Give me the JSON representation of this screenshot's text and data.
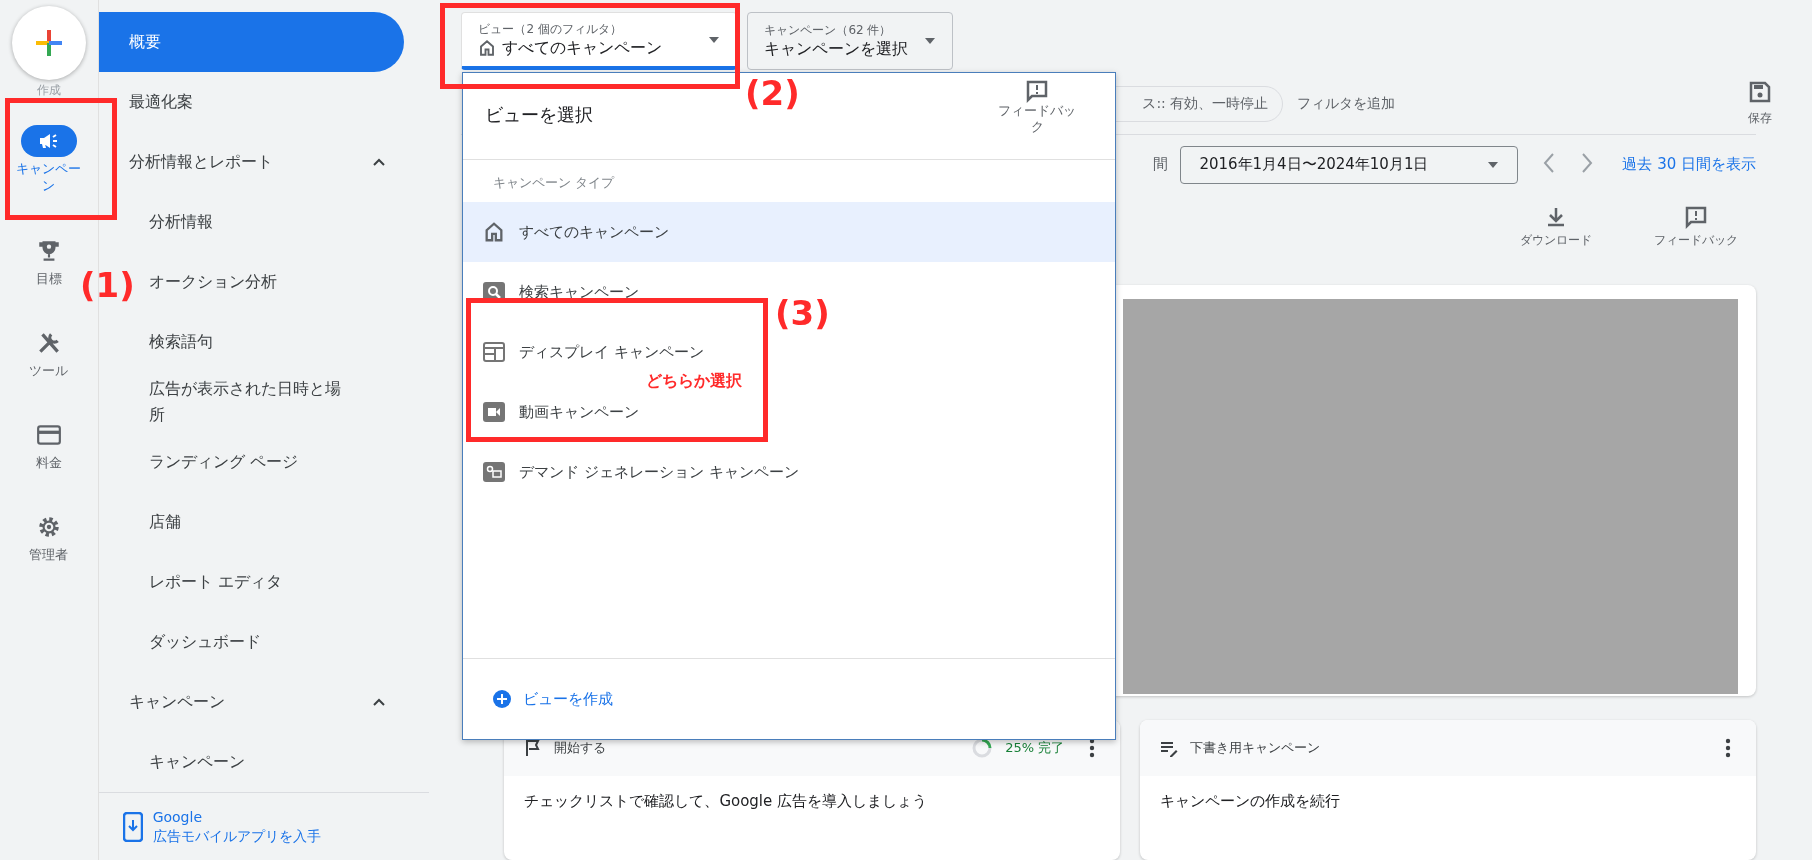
{
  "rail": {
    "create_label": "作成",
    "items": [
      {
        "label": "キャンペーン",
        "kind": "megaphone",
        "selected": true
      },
      {
        "label": "目標",
        "kind": "trophy",
        "selected": false
      },
      {
        "label": "ツール",
        "kind": "tools",
        "selected": false
      },
      {
        "label": "料金",
        "kind": "card",
        "selected": false
      },
      {
        "label": "管理者",
        "kind": "gear",
        "selected": false
      }
    ]
  },
  "sidebar": {
    "items": [
      {
        "label": "概要",
        "selected": true
      },
      {
        "label": "最適化案",
        "selected": false
      },
      {
        "label": "分析情報とレポート",
        "selected": false,
        "expanded": true,
        "children": [
          {
            "label": "分析情報",
            "selected": false
          },
          {
            "label": "オークション分析",
            "selected": false
          },
          {
            "label": "検索語句",
            "selected": false
          },
          {
            "label": "広告が表示された日時と場所",
            "selected": false
          },
          {
            "label": "ランディング ページ",
            "selected": false
          },
          {
            "label": "店舗",
            "selected": false
          },
          {
            "label": "レポート エディタ",
            "selected": false
          },
          {
            "label": "ダッシュボード",
            "selected": false
          }
        ]
      },
      {
        "label": "キャンペーン",
        "selected": false,
        "expanded": true,
        "children": [
          {
            "label": "キャンペーン",
            "selected": false
          }
        ]
      }
    ],
    "app_link": {
      "line1": "Google",
      "line2": "広告モバイルアプリを入手"
    }
  },
  "view_select": {
    "label": "ビュー（2 個のフィルタ）",
    "value": "すべてのキャンペーン",
    "open": true
  },
  "campaign_select": {
    "label": "キャンペーン（62 件）",
    "value": "キャンペーンを選択"
  },
  "filters": {
    "chip": "ス:: 有効、一時停止",
    "add": "フィルタを追加",
    "save": "保存"
  },
  "date": {
    "label": "間",
    "range": "2016年1月4日〜2024年10月1日",
    "link": "過去 30 日間を表示"
  },
  "actions": [
    {
      "label": "ダウンロード",
      "kind": "download"
    },
    {
      "label": "フィードバック",
      "kind": "feedback"
    }
  ],
  "view_panel": {
    "title": "ビューを選択",
    "feedback": "フィードバック",
    "section": "キャンペーン タイプ",
    "options": [
      {
        "label": "すべてのキャンペーン",
        "kind": "all",
        "selected": true
      },
      {
        "label": "検索キャンペーン",
        "kind": "search",
        "selected": false
      },
      {
        "label": "ディスプレイ キャンペーン",
        "kind": "display",
        "selected": false
      },
      {
        "label": "動画キャンペーン",
        "kind": "video",
        "selected": false
      },
      {
        "label": "デマンド ジェネレーション キャンペーン",
        "kind": "demand",
        "selected": false
      }
    ],
    "create": "ビューを作成"
  },
  "cards": [
    {
      "kind": "start",
      "title": "開始する",
      "progress": {
        "level": 0.25,
        "label": "25% 完了"
      },
      "body": "チェックリストで確認して、Google 広告を導入しましょう"
    },
    {
      "kind": "draft",
      "title": "下書き用キャンペーン",
      "body": "キャンペーンの作成を続行"
    }
  ],
  "annotations": [
    {
      "label": "(1)"
    },
    {
      "label": "(2)"
    },
    {
      "label": "(3)",
      "note": "どちらか選択"
    }
  ]
}
